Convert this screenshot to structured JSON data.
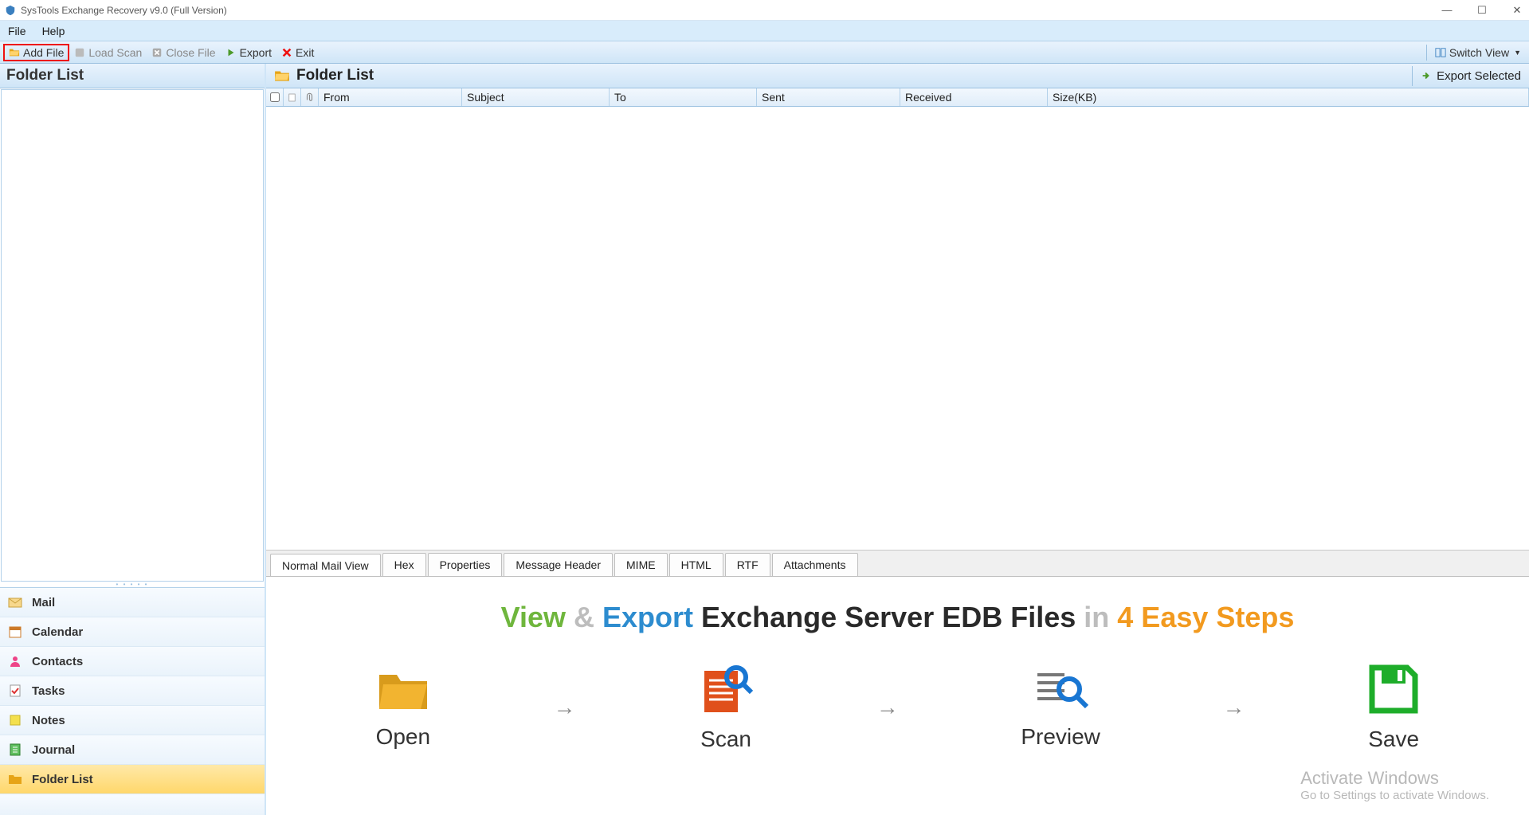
{
  "title": "SysTools Exchange Recovery v9.0 (Full Version)",
  "menu": {
    "file": "File",
    "help": "Help"
  },
  "toolbar": {
    "add_file": "Add File",
    "load_scan": "Load Scan",
    "close_file": "Close File",
    "export": "Export",
    "exit": "Exit",
    "switch_view": "Switch View"
  },
  "left": {
    "header": "Folder List",
    "nav": [
      "Mail",
      "Calendar",
      "Contacts",
      "Tasks",
      "Notes",
      "Journal",
      "Folder List"
    ]
  },
  "right": {
    "header": "Folder List",
    "export_selected": "Export Selected",
    "columns": {
      "from": "From",
      "subject": "Subject",
      "to": "To",
      "sent": "Sent",
      "received": "Received",
      "size": "Size(KB)"
    },
    "tabs": [
      "Normal Mail View",
      "Hex",
      "Properties",
      "Message Header",
      "MIME",
      "HTML",
      "RTF",
      "Attachments"
    ]
  },
  "preview": {
    "headline": {
      "view": "View",
      "amp": "&",
      "export": "Export",
      "mid": "Exchange Server EDB Files",
      "in": "in",
      "easy": "4 Easy Steps"
    },
    "steps": [
      "Open",
      "Scan",
      "Preview",
      "Save"
    ]
  },
  "watermark": {
    "line1": "Activate Windows",
    "line2": "Go to Settings to activate Windows."
  }
}
